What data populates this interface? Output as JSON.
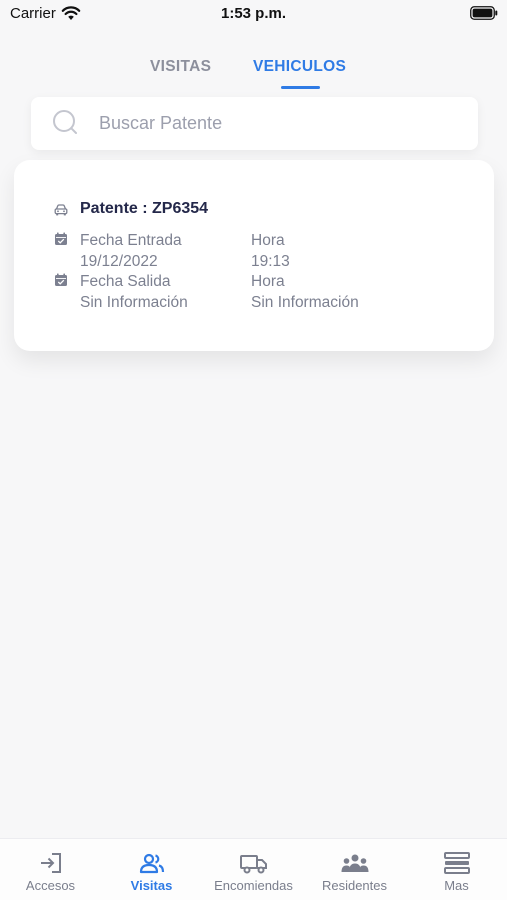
{
  "status_bar": {
    "carrier": "Carrier",
    "time": "1:53 p.m."
  },
  "tabs": [
    {
      "label": "VISITAS",
      "active": false
    },
    {
      "label": "VEHICULOS",
      "active": true
    }
  ],
  "search": {
    "placeholder": "Buscar Patente",
    "value": ""
  },
  "vehicle": {
    "patente": "Patente : ZP6354",
    "fecha_entrada_label": "Fecha Entrada",
    "fecha_entrada_value": "19/12/2022",
    "hora_entrada_label": "Hora",
    "hora_entrada_value": "19:13",
    "fecha_salida_label": "Fecha Salida",
    "fecha_salida_value": "Sin Información",
    "hora_salida_label": "Hora",
    "hora_salida_value": "Sin Información"
  },
  "bottom_nav": [
    {
      "label": "Accesos",
      "icon": "login-icon",
      "active": false
    },
    {
      "label": "Visitas",
      "icon": "people-icon",
      "active": true
    },
    {
      "label": "Encomiendas",
      "icon": "truck-icon",
      "active": false
    },
    {
      "label": "Residentes",
      "icon": "group-icon",
      "active": false
    },
    {
      "label": "Mas",
      "icon": "menu-icon",
      "active": false
    }
  ],
  "colors": {
    "accent": "#2f7be5",
    "muted": "#7c8090",
    "title": "#24284a",
    "background": "#f7f7f8"
  }
}
